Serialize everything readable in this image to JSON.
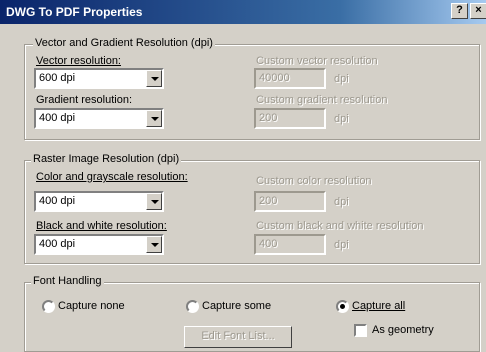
{
  "window": {
    "title": "DWG To PDF Properties",
    "help_label": "?",
    "close_label": "×"
  },
  "vector": {
    "group_label": "Vector and Gradient Resolution (dpi)",
    "vector_label": "Vector resolution:",
    "vector_value": "600 dpi",
    "custom_vector_label": "Custom vector resolution",
    "custom_vector_value": "40000",
    "custom_vector_unit": "dpi",
    "gradient_label": "Gradient resolution:",
    "gradient_value": "400 dpi",
    "custom_gradient_label": "Custom gradient resolution",
    "custom_gradient_value": "200",
    "custom_gradient_unit": "dpi"
  },
  "raster": {
    "group_label": "Raster Image Resolution (dpi)",
    "color_label": "Color and grayscale resolution:",
    "color_value": "400 dpi",
    "custom_color_label": "Custom color resolution",
    "custom_color_value": "200",
    "custom_color_unit": "dpi",
    "bw_label": "Black and white resolution:",
    "bw_value": "400 dpi",
    "custom_bw_label": "Custom black and white resolution",
    "custom_bw_value": "400",
    "custom_bw_unit": "dpi"
  },
  "font": {
    "group_label": "Font Handling",
    "capture_none": "Capture none",
    "capture_some": "Capture some",
    "capture_all": "Capture all",
    "selected": "capture_all",
    "edit_font_list": "Edit Font List...",
    "as_geometry": "As geometry",
    "as_geometry_checked": false
  }
}
